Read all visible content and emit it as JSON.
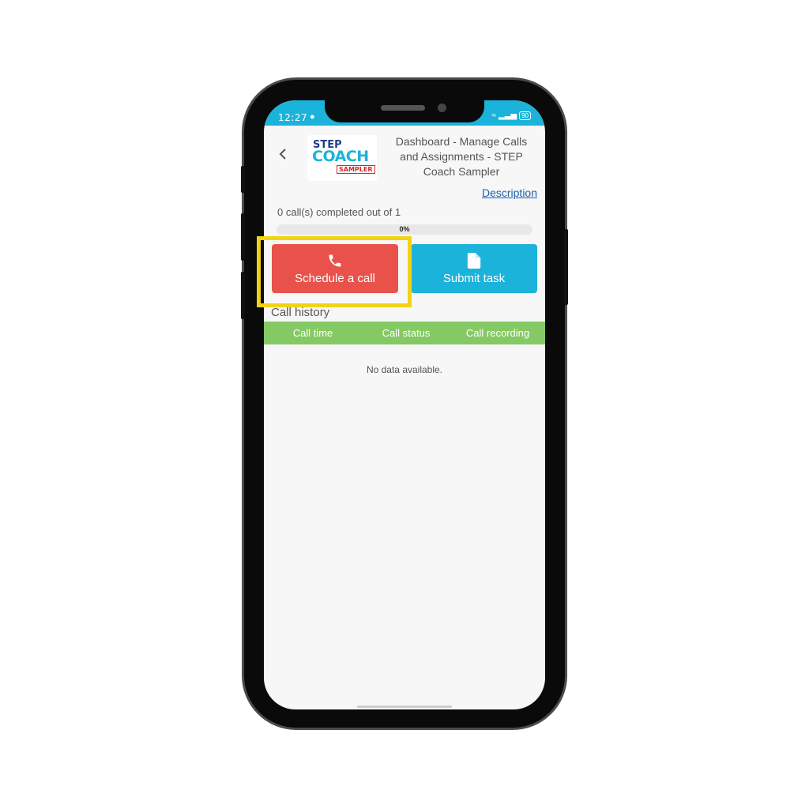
{
  "status_bar": {
    "time": "12:27",
    "battery": "90"
  },
  "header": {
    "title": "Dashboard - Manage Calls and Assignments - STEP Coach Sampler",
    "logo": {
      "step": "STEP",
      "coach": "COACH",
      "sampler": "SAMPLER"
    },
    "description_link": "Description"
  },
  "progress": {
    "text": "0 call(s) completed out of 1",
    "percent_label": "0%",
    "value": 0
  },
  "actions": {
    "schedule_label": "Schedule a call",
    "submit_label": "Submit task"
  },
  "call_history": {
    "title": "Call history",
    "columns": [
      "Call time",
      "Call status",
      "Call recording"
    ],
    "empty_text": "No data available."
  },
  "colors": {
    "status_bar": "#1bb3d9",
    "schedule_button": "#e8524a",
    "submit_button": "#1bb3d9",
    "table_header": "#85c965",
    "highlight": "#f2d314",
    "link": "#1f5fa8"
  },
  "icons": {
    "back": "chevron-left-icon",
    "phone": "phone-icon",
    "document": "document-icon"
  }
}
